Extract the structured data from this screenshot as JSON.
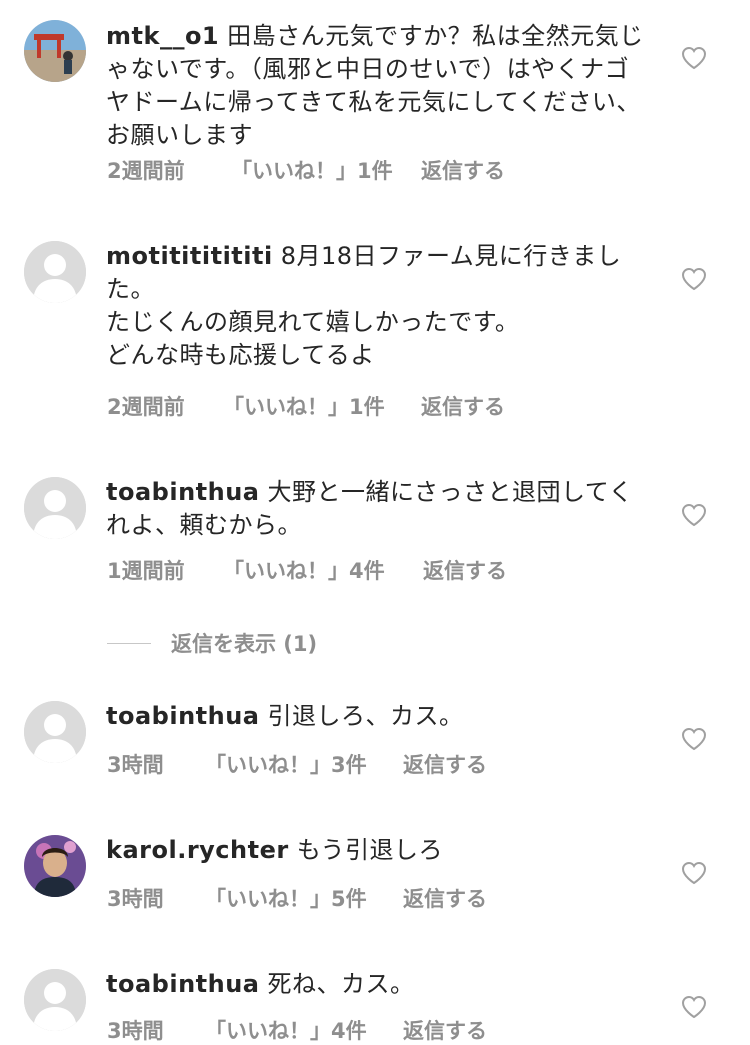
{
  "comments": [
    {
      "username": "mtk__o1",
      "text": "田島さん元気ですか？私は全然元気じゃないです。（風邪と中日のせいで）はやくナゴヤドームに帰ってきて私を元気にしてください、お願いします",
      "time": "2週間前",
      "likes": "「いいね！」1件",
      "reply": "返信する",
      "avatar": "photo-avatar"
    },
    {
      "username": "motitititititi",
      "text": "8月18日ファーム見に行きました。\nたじくんの顔見れて嬉しかったです。\nどんな時も応援してるよ",
      "time": "2週間前",
      "likes": "「いいね！」1件",
      "reply": "返信する",
      "avatar": "default-avatar"
    },
    {
      "username": "toabinthua",
      "text": "大野と一緒にさっさと退団してくれよ、頼むから。",
      "time": "1週間前",
      "likes": "「いいね！」4件",
      "reply": "返信する",
      "avatar": "default-avatar"
    },
    {
      "username": "toabinthua",
      "text": "引退しろ、カス。",
      "time": "3時間",
      "likes": "「いいね！」3件",
      "reply": "返信する",
      "avatar": "default-avatar"
    },
    {
      "username": "karol.rychter",
      "text": "もう引退しろ",
      "time": "3時間",
      "likes": "「いいね！」5件",
      "reply": "返信する",
      "avatar": "photo-avatar"
    },
    {
      "username": "toabinthua",
      "text": "死ね、カス。",
      "time": "3時間",
      "likes": "「いいね！」4件",
      "reply": "返信する",
      "avatar": "default-avatar"
    }
  ],
  "view_replies_label": "返信を表示 (1)",
  "icons": {
    "like": "heart-outline-icon"
  },
  "colors": {
    "text": "#262626",
    "meta": "#8e8e8e",
    "avatar_bg": "#dbdbdb"
  }
}
